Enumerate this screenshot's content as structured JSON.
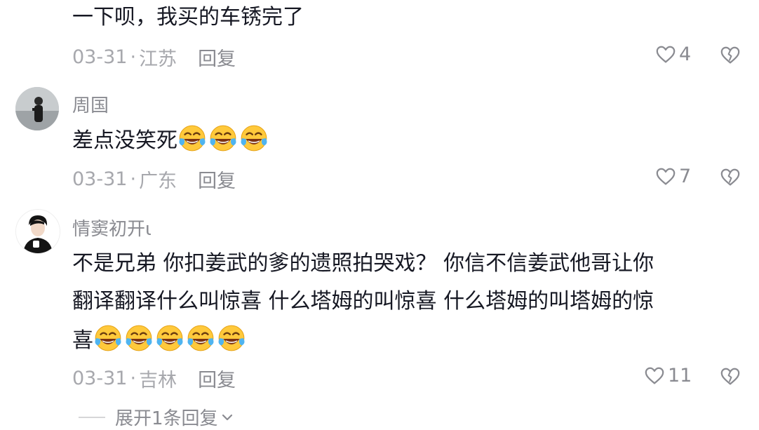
{
  "comments": [
    {
      "text": "一下呗，我买的车锈完了",
      "date": "03-31",
      "location": "江苏",
      "likes": "4"
    },
    {
      "username": "周国",
      "text": "差点没笑死",
      "emojis": [
        "laugh-cry",
        "laugh-cry",
        "laugh-cry"
      ],
      "date": "03-31",
      "location": "广东",
      "likes": "7"
    },
    {
      "username": "情窦初开ι",
      "lines": [
        "不是兄弟 你扣姜武的爹的遗照拍哭戏？ 你信不信姜武他哥让你",
        "翻译翻译什么叫惊喜 什么塔姆的叫惊喜 什么塔姆的叫塔姆的惊",
        "喜"
      ],
      "emojis": [
        "laugh-cry",
        "laugh-cry",
        "laugh-cry",
        "laugh-cry",
        "laugh-cry"
      ],
      "date": "03-31",
      "location": "吉林",
      "likes": "11"
    }
  ],
  "ui": {
    "separator": "·",
    "reply_label": "回复",
    "expand_label": "展开1条回复"
  },
  "icons": {
    "like": "heart-outline-icon",
    "dislike": "broken-heart-icon",
    "expand": "chevron-down-icon"
  },
  "colors": {
    "text": "#161823",
    "meta": "#a7a8ad",
    "secondary": "#8a8b91"
  }
}
